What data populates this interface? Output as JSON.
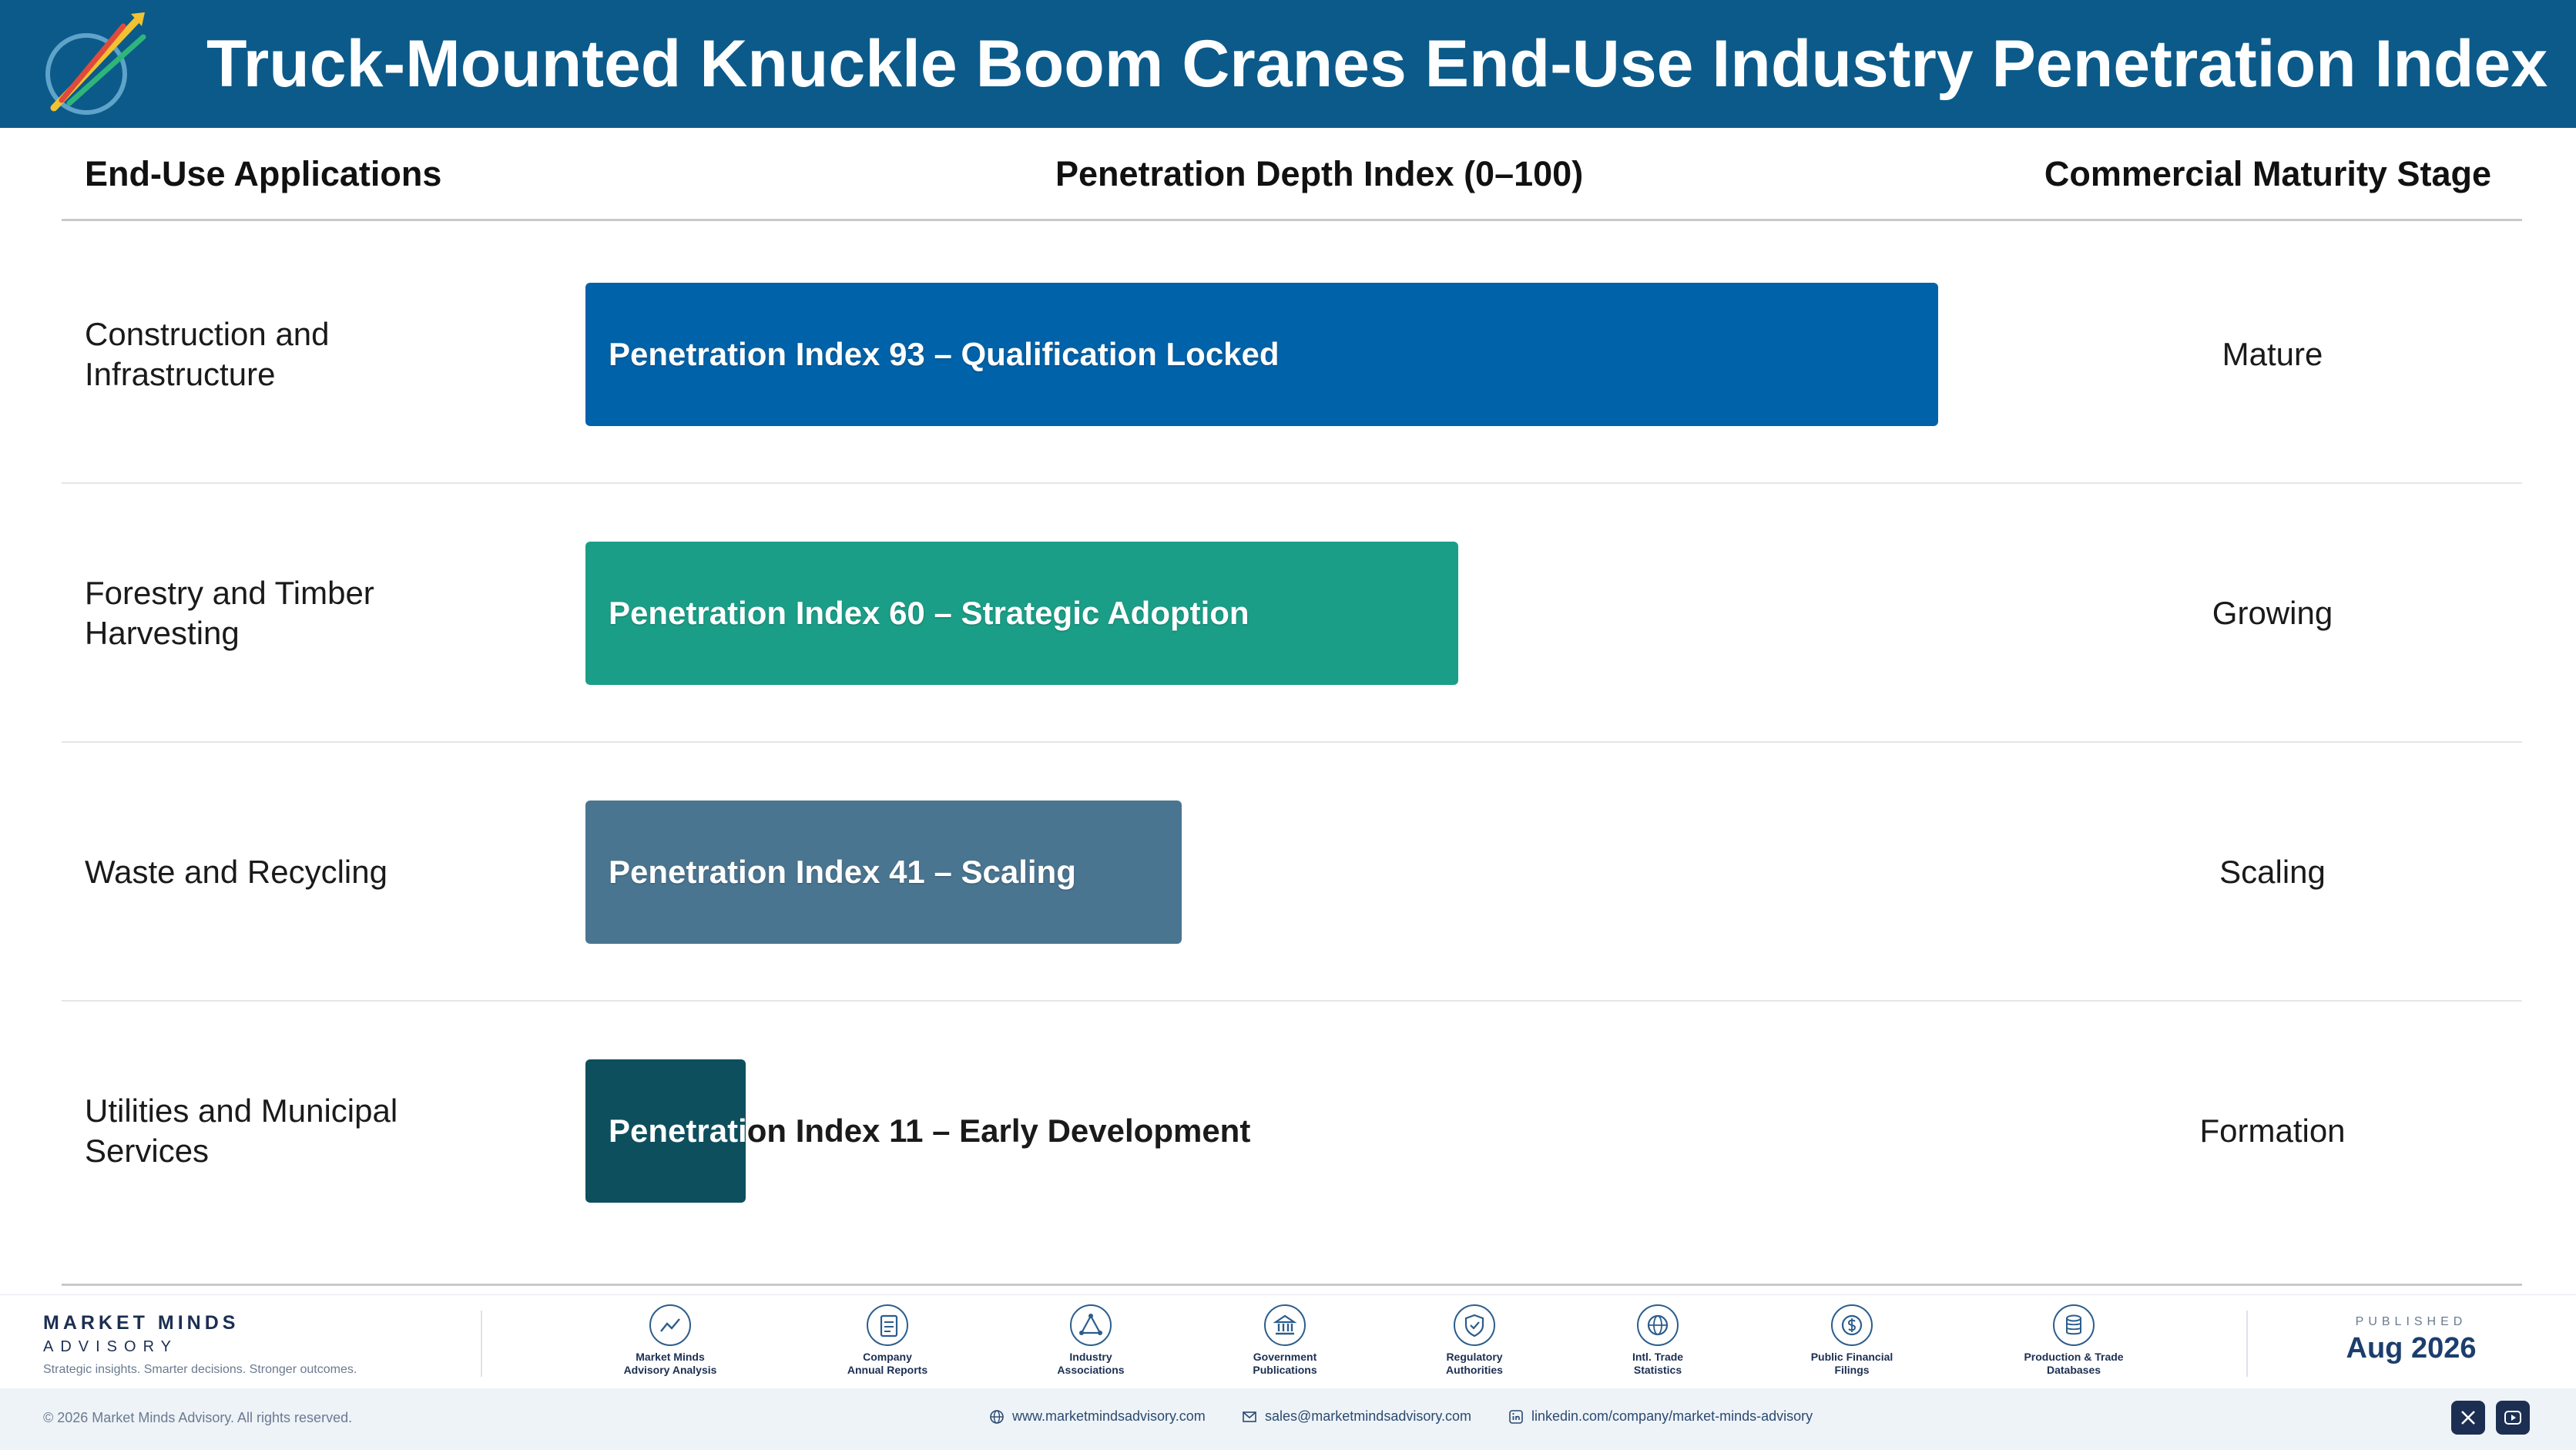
{
  "header": {
    "title": "Truck-Mounted Knuckle Boom Cranes End-Use Industry Penetration Index"
  },
  "columns": {
    "applications": "End-Use Applications",
    "index": "Penetration Depth Index (0–100)",
    "stage": "Commercial Maturity Stage"
  },
  "chart_data": {
    "type": "bar",
    "orientation": "horizontal",
    "title": "Truck-Mounted Knuckle Boom Cranes End-Use Industry Penetration Index",
    "xlabel": "Penetration Depth Index (0–100)",
    "xlim": [
      0,
      100
    ],
    "categories": [
      "Construction and Infrastructure",
      "Forestry and Timber Harvesting",
      "Waste and Recycling",
      "Utilities and Municipal Services"
    ],
    "values": [
      93,
      60,
      41,
      11
    ],
    "bar_labels": [
      "Penetration Index 93 – Qualification Locked",
      "Penetration Index 60 – Strategic Adoption",
      "Penetration Index 41 – Scaling",
      "Penetration Index 11 – Early Development"
    ],
    "stages": [
      "Mature",
      "Growing",
      "Scaling",
      "Formation"
    ],
    "colors": [
      "#0062a8",
      "#1b9e87",
      "#4a7590",
      "#0e4f5e"
    ]
  },
  "footer": {
    "brand_name": "MARKET MINDS",
    "brand_sub": "ADVISORY",
    "brand_tagline": "Strategic insights. Smarter decisions. Stronger outcomes.",
    "sources": [
      {
        "line1": "Market Minds",
        "line2": "Advisory Analysis",
        "icon": "chart-line-icon"
      },
      {
        "line1": "Company",
        "line2": "Annual Reports",
        "icon": "document-icon"
      },
      {
        "line1": "Industry",
        "line2": "Associations",
        "icon": "network-icon"
      },
      {
        "line1": "Government",
        "line2": "Publications",
        "icon": "building-icon"
      },
      {
        "line1": "Regulatory",
        "line2": "Authorities",
        "icon": "shield-icon"
      },
      {
        "line1": "Intl. Trade",
        "line2": "Statistics",
        "icon": "globe-icon"
      },
      {
        "line1": "Public Financial",
        "line2": "Filings",
        "icon": "dollar-icon"
      },
      {
        "line1": "Production & Trade",
        "line2": "Databases",
        "icon": "database-icon"
      }
    ],
    "published_label": "PUBLISHED",
    "published_date": "Aug 2026",
    "copyright": "© 2026 Market Minds Advisory. All rights reserved.",
    "website": "www.marketmindsadvisory.com",
    "email": "sales@marketmindsadvisory.com",
    "linkedin": "linkedin.com/company/market-minds-advisory"
  }
}
